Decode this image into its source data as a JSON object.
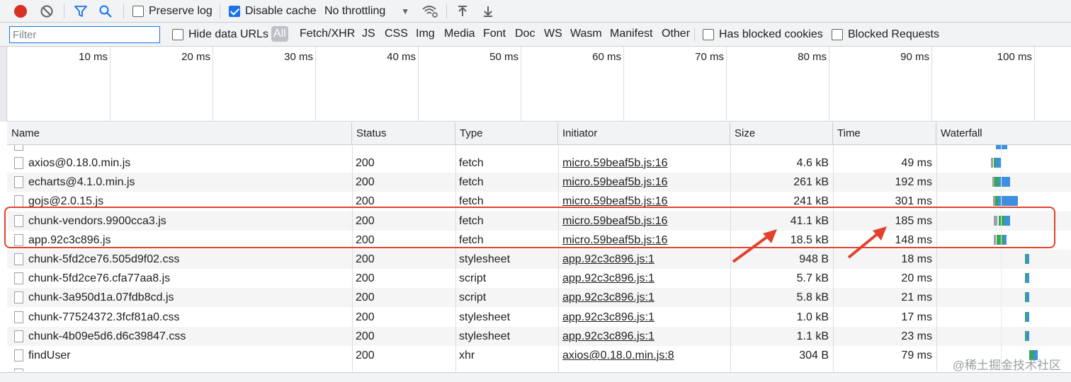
{
  "toolbar": {
    "preserve_log_label": "Preserve log",
    "preserve_log_checked": false,
    "disable_cache_label": "Disable cache",
    "disable_cache_checked": true,
    "throttling_value": "No throttling",
    "icons": [
      "record-icon",
      "clear-icon",
      "filter-icon",
      "search-icon",
      "wifi-settings-icon",
      "import-icon",
      "export-icon"
    ]
  },
  "filter_bar": {
    "filter_placeholder": "Filter",
    "hide_data_urls_label": "Hide data URLs",
    "types": [
      "All",
      "Fetch/XHR",
      "JS",
      "CSS",
      "Img",
      "Media",
      "Font",
      "Doc",
      "WS",
      "Wasm",
      "Manifest",
      "Other"
    ],
    "active_type": "All",
    "blocked_cookies_label": "Has blocked cookies",
    "blocked_requests_label": "Blocked Requests"
  },
  "overview": {
    "ticks": [
      "10 ms",
      "20 ms",
      "30 ms",
      "40 ms",
      "50 ms",
      "60 ms",
      "70 ms",
      "80 ms",
      "90 ms",
      "100 ms"
    ]
  },
  "table": {
    "headers": {
      "name": "Name",
      "status": "Status",
      "type": "Type",
      "initiator": "Initiator",
      "size": "Size",
      "time": "Time",
      "waterfall": "Waterfall"
    },
    "rows": [
      {
        "name": "axios@0.18.0.min.js",
        "status": "200",
        "type": "fetch",
        "initiator": "micro.59beaf5b.js:16",
        "size": "4.6 kB",
        "time": "49 ms"
      },
      {
        "name": "echarts@4.1.0.min.js",
        "status": "200",
        "type": "fetch",
        "initiator": "micro.59beaf5b.js:16",
        "size": "261 kB",
        "time": "192 ms"
      },
      {
        "name": "gojs@2.0.15.js",
        "status": "200",
        "type": "fetch",
        "initiator": "micro.59beaf5b.js:16",
        "size": "241 kB",
        "time": "301 ms"
      },
      {
        "name": "chunk-vendors.9900cca3.js",
        "status": "200",
        "type": "fetch",
        "initiator": "micro.59beaf5b.js:16",
        "size": "41.1 kB",
        "time": "185 ms"
      },
      {
        "name": "app.92c3c896.js",
        "status": "200",
        "type": "fetch",
        "initiator": "micro.59beaf5b.js:16",
        "size": "18.5 kB",
        "time": "148 ms"
      },
      {
        "name": "chunk-5fd2ce76.505d9f02.css",
        "status": "200",
        "type": "stylesheet",
        "initiator": "app.92c3c896.js:1",
        "size": "948 B",
        "time": "18 ms"
      },
      {
        "name": "chunk-5fd2ce76.cfa77aa8.js",
        "status": "200",
        "type": "script",
        "initiator": "app.92c3c896.js:1",
        "size": "5.7 kB",
        "time": "20 ms"
      },
      {
        "name": "chunk-3a950d1a.07fdb8cd.js",
        "status": "200",
        "type": "script",
        "initiator": "app.92c3c896.js:1",
        "size": "5.8 kB",
        "time": "21 ms"
      },
      {
        "name": "chunk-77524372.3fcf81a0.css",
        "status": "200",
        "type": "stylesheet",
        "initiator": "app.92c3c896.js:1",
        "size": "1.0 kB",
        "time": "17 ms"
      },
      {
        "name": "chunk-4b09e5d6.d6c39847.css",
        "status": "200",
        "type": "stylesheet",
        "initiator": "app.92c3c896.js:1",
        "size": "1.1 kB",
        "time": "23 ms"
      },
      {
        "name": "findUser",
        "status": "200",
        "type": "xhr",
        "initiator": "axios@0.18.0.min.js:8",
        "size": "304 B",
        "time": "79 ms"
      }
    ]
  },
  "colors": {
    "highlight": "#e2412e",
    "accent": "#1a73e8",
    "waterfall_wait": "#34a853",
    "waterfall_download": "#3d8fe0"
  },
  "watermark": "@稀土掘金技术社区"
}
